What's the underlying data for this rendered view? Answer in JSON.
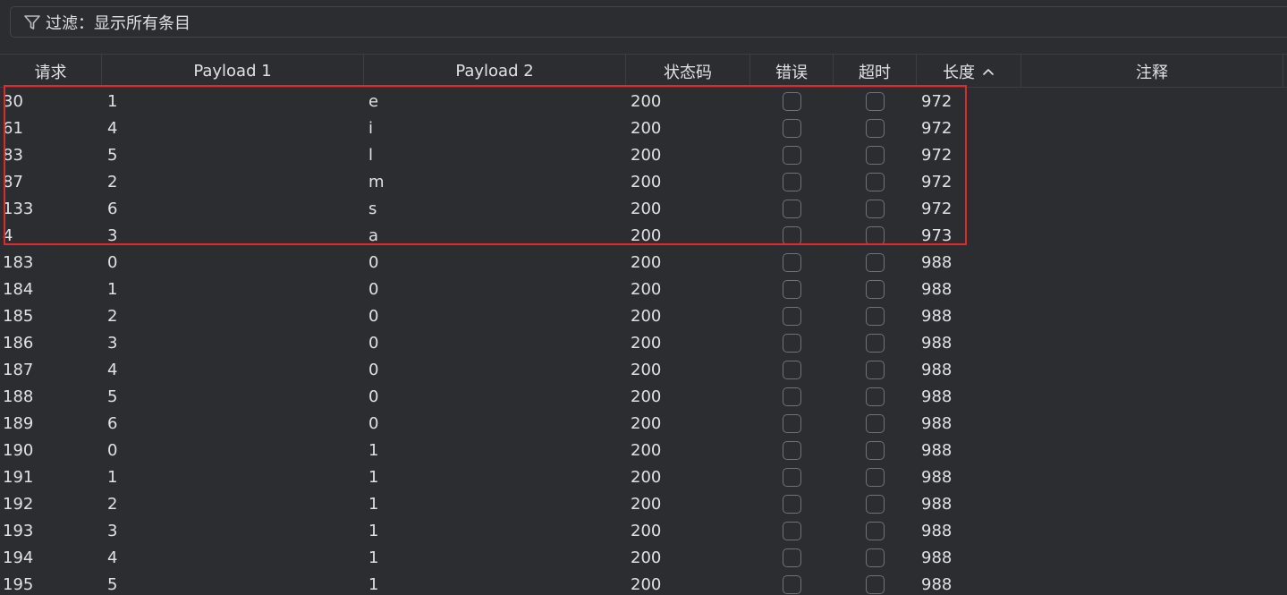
{
  "filter": {
    "icon": "filter-icon",
    "label": "过滤：显示所有条目"
  },
  "columns": {
    "request": "请求",
    "payload1": "Payload 1",
    "payload2": "Payload 2",
    "status": "状态码",
    "error": "错误",
    "timeout": "超时",
    "length": "长度",
    "length_sort": "sort-ascending-icon",
    "comment": "注释"
  },
  "rows": [
    {
      "request": "30",
      "payload1": "1",
      "payload2": "e",
      "status": "200",
      "error": false,
      "timeout": false,
      "length": "972",
      "comment": ""
    },
    {
      "request": "61",
      "payload1": "4",
      "payload2": "i",
      "status": "200",
      "error": false,
      "timeout": false,
      "length": "972",
      "comment": ""
    },
    {
      "request": "83",
      "payload1": "5",
      "payload2": "l",
      "status": "200",
      "error": false,
      "timeout": false,
      "length": "972",
      "comment": ""
    },
    {
      "request": "87",
      "payload1": "2",
      "payload2": "m",
      "status": "200",
      "error": false,
      "timeout": false,
      "length": "972",
      "comment": ""
    },
    {
      "request": "133",
      "payload1": "6",
      "payload2": "s",
      "status": "200",
      "error": false,
      "timeout": false,
      "length": "972",
      "comment": ""
    },
    {
      "request": "4",
      "payload1": "3",
      "payload2": "a",
      "status": "200",
      "error": false,
      "timeout": false,
      "length": "973",
      "comment": ""
    },
    {
      "request": "183",
      "payload1": "0",
      "payload2": "0",
      "status": "200",
      "error": false,
      "timeout": false,
      "length": "988",
      "comment": ""
    },
    {
      "request": "184",
      "payload1": "1",
      "payload2": "0",
      "status": "200",
      "error": false,
      "timeout": false,
      "length": "988",
      "comment": ""
    },
    {
      "request": "185",
      "payload1": "2",
      "payload2": "0",
      "status": "200",
      "error": false,
      "timeout": false,
      "length": "988",
      "comment": ""
    },
    {
      "request": "186",
      "payload1": "3",
      "payload2": "0",
      "status": "200",
      "error": false,
      "timeout": false,
      "length": "988",
      "comment": ""
    },
    {
      "request": "187",
      "payload1": "4",
      "payload2": "0",
      "status": "200",
      "error": false,
      "timeout": false,
      "length": "988",
      "comment": ""
    },
    {
      "request": "188",
      "payload1": "5",
      "payload2": "0",
      "status": "200",
      "error": false,
      "timeout": false,
      "length": "988",
      "comment": ""
    },
    {
      "request": "189",
      "payload1": "6",
      "payload2": "0",
      "status": "200",
      "error": false,
      "timeout": false,
      "length": "988",
      "comment": ""
    },
    {
      "request": "190",
      "payload1": "0",
      "payload2": "1",
      "status": "200",
      "error": false,
      "timeout": false,
      "length": "988",
      "comment": ""
    },
    {
      "request": "191",
      "payload1": "1",
      "payload2": "1",
      "status": "200",
      "error": false,
      "timeout": false,
      "length": "988",
      "comment": ""
    },
    {
      "request": "192",
      "payload1": "2",
      "payload2": "1",
      "status": "200",
      "error": false,
      "timeout": false,
      "length": "988",
      "comment": ""
    },
    {
      "request": "193",
      "payload1": "3",
      "payload2": "1",
      "status": "200",
      "error": false,
      "timeout": false,
      "length": "988",
      "comment": ""
    },
    {
      "request": "194",
      "payload1": "4",
      "payload2": "1",
      "status": "200",
      "error": false,
      "timeout": false,
      "length": "988",
      "comment": ""
    },
    {
      "request": "195",
      "payload1": "5",
      "payload2": "1",
      "status": "200",
      "error": false,
      "timeout": false,
      "length": "988",
      "comment": ""
    }
  ],
  "highlight": {
    "color": "#e0282d"
  },
  "colors": {
    "background": "#2b2d30",
    "text": "#dfe1e5",
    "grid": "#3c3f41",
    "checkbox_border": "#6f737a"
  }
}
